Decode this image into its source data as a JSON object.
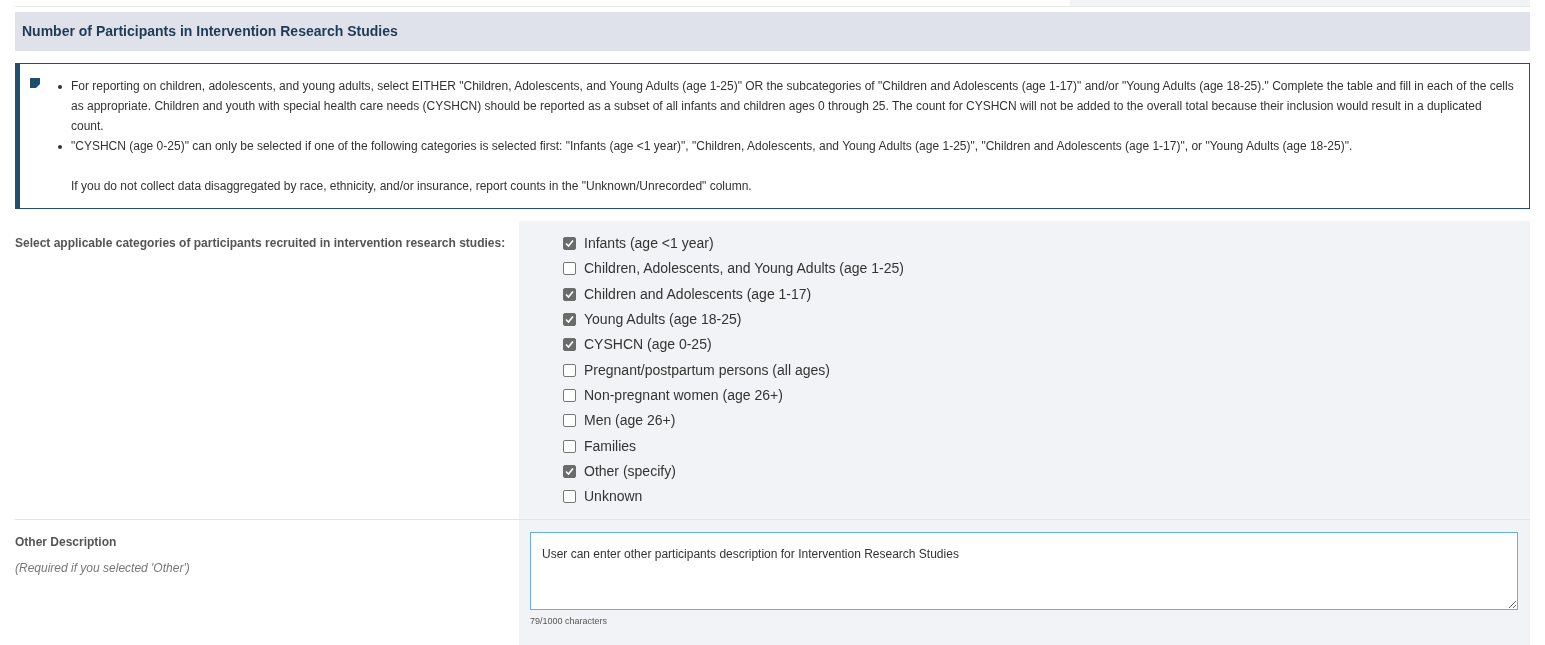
{
  "section_title": "Number of Participants in Intervention Research Studies",
  "info": {
    "bullets": [
      "For reporting on children, adolescents, and young adults, select EITHER \"Children, Adolescents, and Young Adults (age 1-25)\" OR the subcategories of \"Children and Adolescents (age 1-17)\" and/or \"Young Adults (age 18-25).\" Complete the table and fill in each of the cells as appropriate. Children and youth with special health care needs (CYSHCN) should be reported as a subset of all infants and children ages 0 through 25. The count for CYSHCN will not be added to the overall total because their inclusion would result in a duplicated count.",
      "\"CYSHCN (age 0-25)\" can only be selected if one of the following categories is selected first: \"Infants (age <1 year)\", \"Children, Adolescents, and Young Adults (age 1-25)\", \"Children and Adolescents (age 1-17)\", or \"Young Adults (age 18-25)\"."
    ],
    "note": "If you do not collect data disaggregated by race, ethnicity, and/or insurance, report counts in the \"Unknown/Unrecorded\" column."
  },
  "categories": {
    "label": "Select applicable categories of participants recruited in intervention research studies:",
    "options": [
      {
        "label": "Infants (age <1 year)",
        "checked": true
      },
      {
        "label": "Children, Adolescents, and Young Adults (age 1-25)",
        "checked": false
      },
      {
        "label": "Children and Adolescents (age 1-17)",
        "checked": true
      },
      {
        "label": "Young Adults (age 18-25)",
        "checked": true
      },
      {
        "label": "CYSHCN (age 0-25)",
        "checked": true
      },
      {
        "label": "Pregnant/postpartum persons (all ages)",
        "checked": false
      },
      {
        "label": "Non-pregnant women (age 26+)",
        "checked": false
      },
      {
        "label": "Men (age 26+)",
        "checked": false
      },
      {
        "label": "Families",
        "checked": false
      },
      {
        "label": "Other (specify)",
        "checked": true
      },
      {
        "label": "Unknown",
        "checked": false
      }
    ]
  },
  "other_description": {
    "label": "Other Description",
    "hint": "(Required if you selected 'Other')",
    "value": "User can enter other participants description for Intervention Research Studies",
    "counter": "79/1000 characters"
  }
}
